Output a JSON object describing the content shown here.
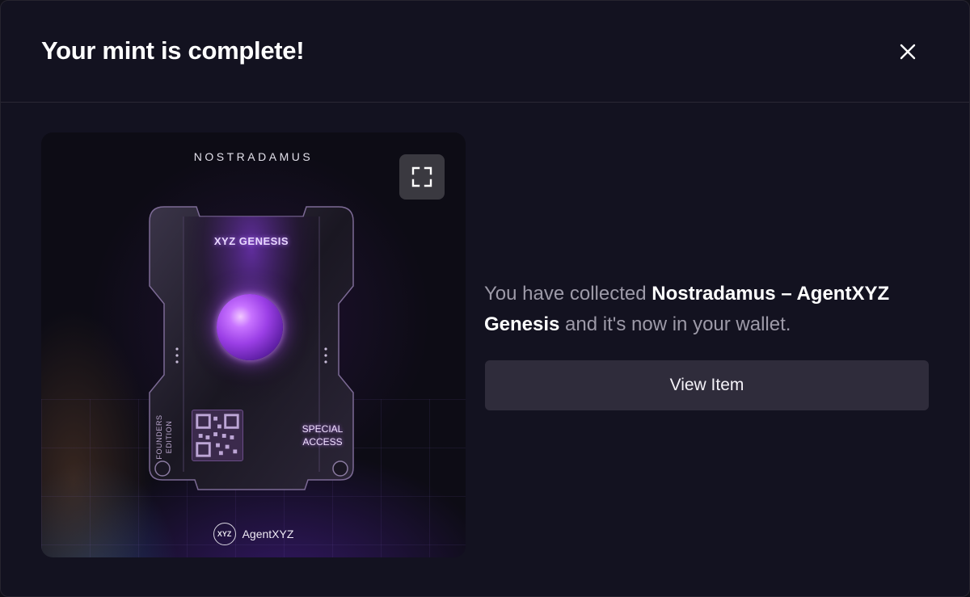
{
  "modal": {
    "title": "Your mint is complete!",
    "close_icon": "close-icon"
  },
  "artwork": {
    "header": "NOSTRADAMUS",
    "expand_icon": "expand-icon",
    "card_title": "XYZ GENESIS",
    "founders_label": "FOUNDERS EDITION",
    "special_label": "SPECIAL ACCESS",
    "brand_logo_text": "XYZ",
    "brand_name": "AgentXYZ"
  },
  "message": {
    "prefix": "You have collected ",
    "item_name": "Nostradamus – AgentXYZ Genesis",
    "suffix": " and it's now in your wallet."
  },
  "actions": {
    "view_item_label": "View Item"
  },
  "colors": {
    "background": "#131220",
    "button": "#2f2c3b",
    "muted_text": "#9d9aa8",
    "accent_glow": "#b06cff"
  }
}
